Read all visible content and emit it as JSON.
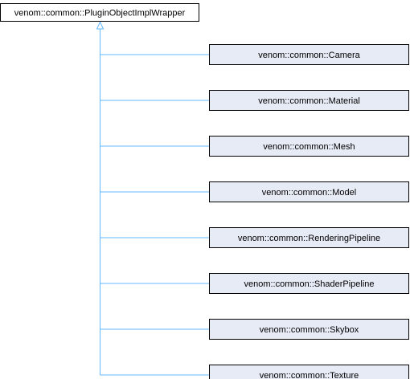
{
  "colors": {
    "node_border": "#000000",
    "base_node_fill": "#ffffff",
    "derived_node_fill": "#e7ebf6",
    "edge": "#63b8ff",
    "text": "#000000"
  },
  "base_class": {
    "label": "venom::common::PluginObjectImplWrapper"
  },
  "derived_classes": [
    {
      "label": "venom::common::Camera"
    },
    {
      "label": "venom::common::Material"
    },
    {
      "label": "venom::common::Mesh"
    },
    {
      "label": "venom::common::Model"
    },
    {
      "label": "venom::common::RenderingPipeline"
    },
    {
      "label": "venom::common::ShaderPipeline"
    },
    {
      "label": "venom::common::Skybox"
    },
    {
      "label": "venom::common::Texture"
    }
  ]
}
